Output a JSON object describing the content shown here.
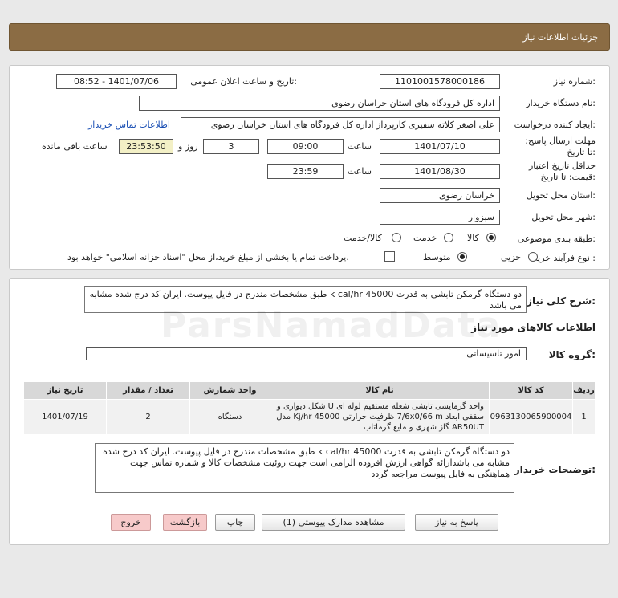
{
  "header": {
    "title": "جزئیات اطلاعات نیاز"
  },
  "form": {
    "need_number_label": "شماره نیاز:",
    "need_number": "1101001578000186",
    "announce_label": "تاریخ و ساعت اعلان عمومی:",
    "announce_value": "1401/07/06 - 08:52",
    "buyer_label": "نام دستگاه خریدار:",
    "buyer_value": "اداره کل فرودگاه های استان خراسان رضوی",
    "creator_label": "ایجاد کننده درخواست:",
    "creator_value": "علی اصغر کلاته سفیری کارپرداز اداره کل فرودگاه های استان خراسان رضوی",
    "contact_link": "اطلاعات تماس خریدار",
    "deadline_label": "مهلت ارسال پاسخ: تا تاریخ:",
    "deadline_date": "1401/07/10",
    "time_label": "ساعت",
    "deadline_time": "09:00",
    "days_value": "3",
    "days_label": "روز و",
    "remaining_time": "23:53:50",
    "remaining_label": "ساعت باقی مانده",
    "validity_label": "حداقل تاریخ اعتبار قیمت: تا تاریخ:",
    "validity_date": "1401/08/30",
    "validity_time": "23:59",
    "province_label": "استان محل تحویل:",
    "province_value": "خراسان رضوی",
    "city_label": "شهر محل تحویل:",
    "city_value": "سبزوار",
    "category_label": "طبقه بندی موضوعی:",
    "category_options": [
      "کالا",
      "خدمت",
      "کالا/خدمت"
    ],
    "process_label": "نوع فرآیند خرید :",
    "process_options": [
      "جزیی",
      "متوسط"
    ],
    "payment_note": "پرداخت تمام یا بخشی از مبلغ خرید،از محل \"اسناد خزانه اسلامی\" خواهد بود."
  },
  "summary": {
    "label": "شرح کلی نیاز:",
    "text": "دو دستگاه گرمکن تابشی به قدرت k cal/hr 45000 طبق مشخصات مندرج در فایل پیوست.  ایران کد درج شده مشابه می باشد"
  },
  "goods": {
    "section_title": "اطلاعات کالاهای مورد نیاز",
    "group_label": "گروه کالا:",
    "group_value": "امور تاسیساتی",
    "columns": [
      "ردیف",
      "کد کالا",
      "نام کالا",
      "واحد شمارش",
      "تعداد / مقدار",
      "تاریخ نیاز"
    ],
    "rows": [
      {
        "index": "1",
        "code": "0963130065900004",
        "name": "واحد گرمایشی تابشی شعله مستقیم لوله ای U شکل دیواری و سقفی ابعاد 7/6x0/66 m ظرفیت حرارتی 45000 Kj/hr مدل AR50UT گاز شهری و مایع گرماتاب",
        "unit": "دستگاه",
        "qty": "2",
        "date": "1401/07/19"
      }
    ]
  },
  "buyer_notes": {
    "label": "توضیحات خریدار:",
    "text": "دو دستگاه گرمکن تابشی به قدرت k cal/hr 45000 طبق مشخصات مندرج در فایل پیوست. ایران کد درج شده مشابه می باشدارائه گواهی ارزش افزوده الزامی است جهت روئیت مشخصات کالا و شماره تماس جهت هماهنگی به فایل پیوست مراجعه گردد"
  },
  "buttons": {
    "reply": "پاسخ به نیاز",
    "attachments": "مشاهده مدارک پیوستی (1)",
    "print": "چاپ",
    "back": "بازگشت",
    "exit": "خروج"
  }
}
